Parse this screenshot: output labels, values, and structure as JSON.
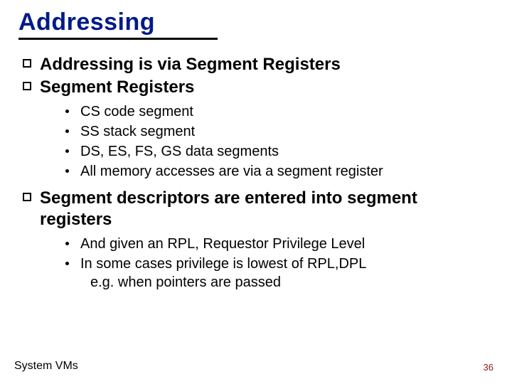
{
  "title": "Addressing",
  "bullets": [
    {
      "text": "Addressing is via Segment Registers",
      "sub": []
    },
    {
      "text": "Segment Registers",
      "sub": [
        {
          "text": "CS  code segment"
        },
        {
          "text": "SS  stack segment"
        },
        {
          "text": "DS, ES, FS, GS  data segments"
        },
        {
          "text": "All memory accesses are via a segment register"
        }
      ]
    },
    {
      "text": "Segment descriptors are entered into segment registers",
      "sub": [
        {
          "text": "And given an RPL,  Requestor Privilege Level"
        },
        {
          "text": "In some cases privilege is lowest of RPL,DPL",
          "subline": "e.g. when pointers are passed"
        }
      ]
    }
  ],
  "footer_left": "System VMs",
  "footer_right": "36"
}
